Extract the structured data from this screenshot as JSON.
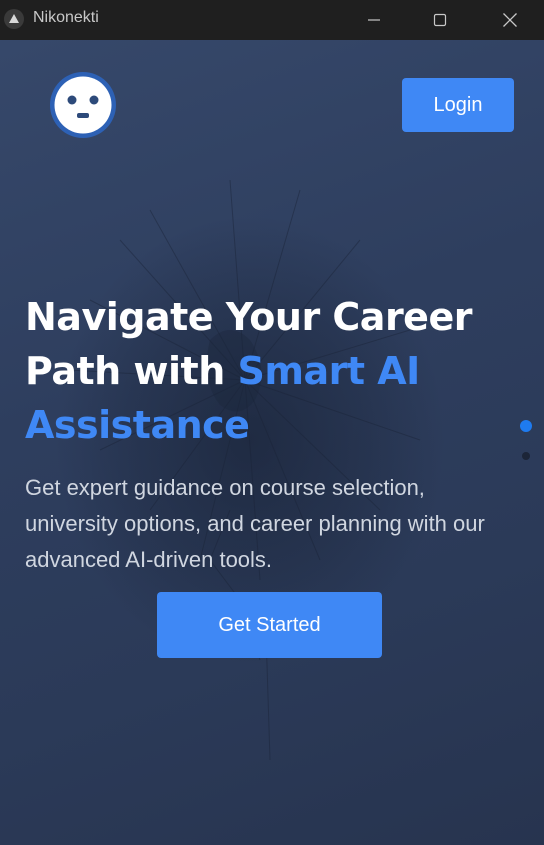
{
  "window": {
    "title": "Nikonekti",
    "controls": [
      "minimize-icon",
      "maximize-icon",
      "close-icon"
    ]
  },
  "header": {
    "logo_icon": "robot-face-icon",
    "login_label": "Login"
  },
  "hero": {
    "headline_white": "Navigate Your Career Path with",
    "headline_accent": "Smart AI Assistance",
    "subtext": "Get expert guidance on course selection, university options, and career planning with our advanced AI-driven tools.",
    "cta_label": "Get Started",
    "slides": {
      "count": 2,
      "active_index": 0
    }
  },
  "colors": {
    "accent": "#3f88f5",
    "background_top": "#36486a",
    "background_bottom": "#27344f",
    "titlebar": "#1f1f1f",
    "headline": "#ffffff",
    "subtext": "#d0d6e0"
  }
}
